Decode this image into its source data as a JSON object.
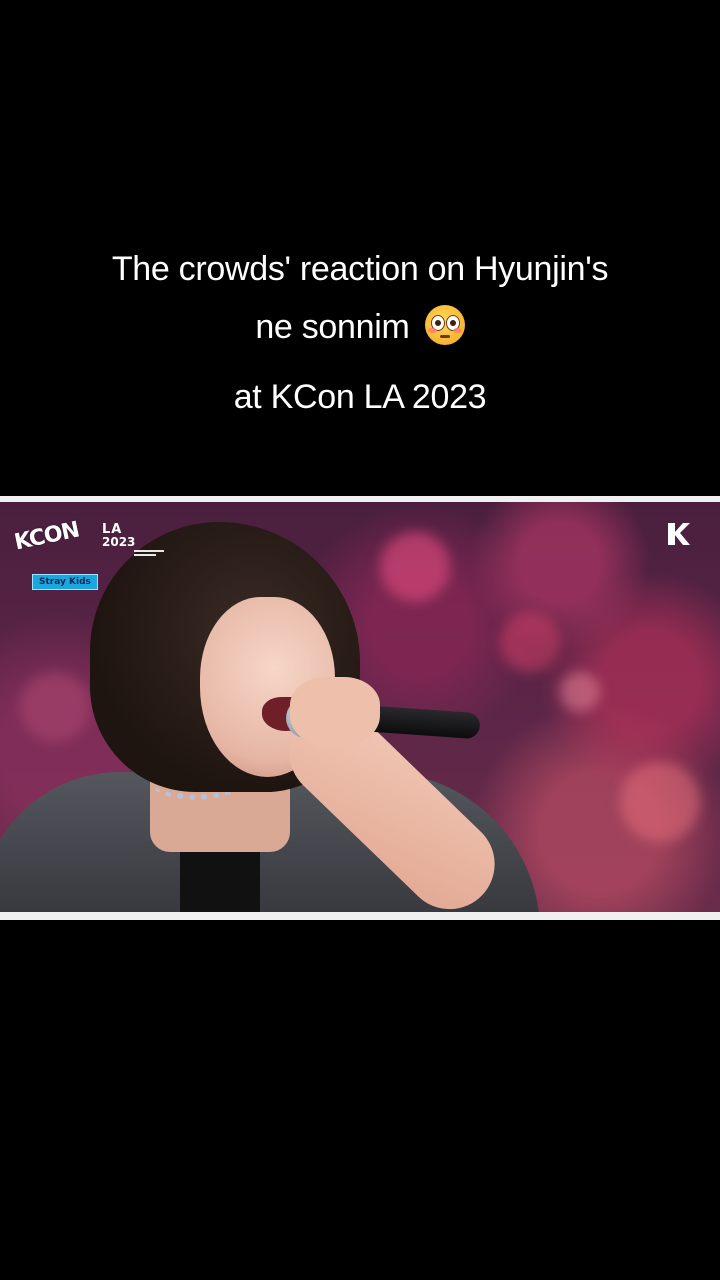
{
  "caption": {
    "line1": "The crowds' reaction on Hyunjin's",
    "line2": "ne sonnim",
    "line2_emoji": "flushed-face-emoji",
    "line3": "at KCon LA 2023"
  },
  "video": {
    "kcon_logo": "KCON",
    "edition_city": "LA",
    "edition_year": "2023",
    "artist_badge": "Stray Kids",
    "corner_logo_icon": "k-logo-icon"
  },
  "colors": {
    "background": "#000000",
    "frame_border": "#f0f0f0",
    "badge": "#1aa7e0",
    "text": "#ffffff"
  }
}
